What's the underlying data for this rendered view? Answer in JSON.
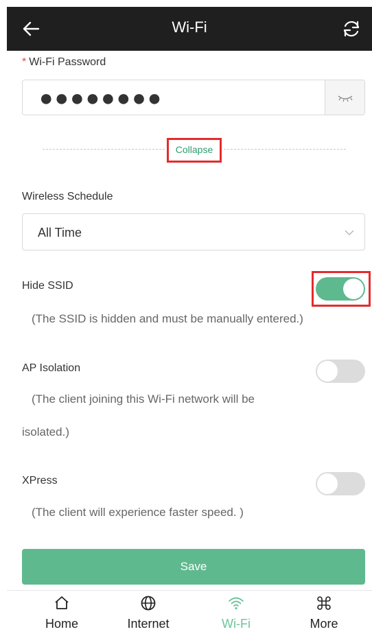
{
  "header": {
    "title": "Wi-Fi",
    "back_icon": "arrow-left-icon",
    "refresh_icon": "refresh-icon"
  },
  "password": {
    "required_mark": "*",
    "label": "Wi-Fi Password",
    "value": "●●●●●●●●",
    "toggle_icon": "eye-closed-icon"
  },
  "collapse": {
    "label": "Collapse"
  },
  "schedule": {
    "label": "Wireless Schedule",
    "value": "All Time"
  },
  "hide_ssid": {
    "label": "Hide SSID",
    "enabled": true,
    "hint": "(The SSID is hidden and must be manually entered.)"
  },
  "ap_isolation": {
    "label": "AP Isolation",
    "enabled": false,
    "hint_line1": "(The client joining this Wi-Fi network will be",
    "hint_line2": "isolated.)"
  },
  "xpress": {
    "label": "XPress",
    "enabled": false,
    "hint": "(The client will experience faster speed. )"
  },
  "save": {
    "label": "Save"
  },
  "colors": {
    "accent": "#5fb98e",
    "header_bg": "#1f1f1f",
    "highlight": "#e32b2b",
    "required": "#e74c3c"
  },
  "tabs": [
    {
      "label": "Home",
      "icon": "home-icon",
      "active": false
    },
    {
      "label": "Internet",
      "icon": "globe-icon",
      "active": false
    },
    {
      "label": "Wi-Fi",
      "icon": "wifi-icon",
      "active": true
    },
    {
      "label": "More",
      "icon": "command-icon",
      "active": false
    }
  ]
}
